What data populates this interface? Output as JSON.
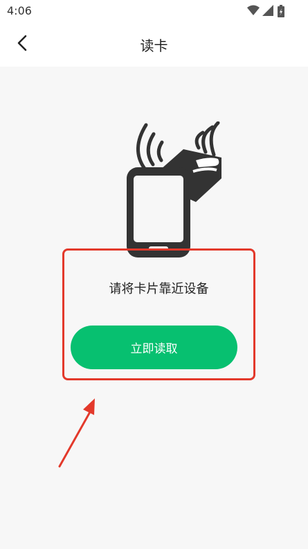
{
  "status_bar": {
    "time": "4:06",
    "icons": [
      "wifi-icon",
      "cell-signal-icon",
      "battery-icon"
    ]
  },
  "header": {
    "title": "读卡",
    "back_icon": "chevron-left-icon"
  },
  "main": {
    "illustration": "phone-nfc-card-icon",
    "prompt": "请将卡片靠近设备",
    "read_button_label": "立即读取"
  },
  "colors": {
    "accent": "#07c070",
    "annotation": "#e3392b",
    "background": "#f7f7f7"
  }
}
